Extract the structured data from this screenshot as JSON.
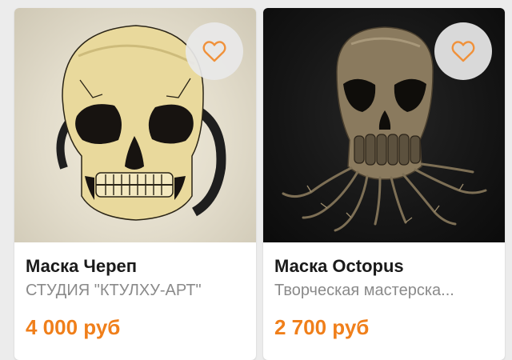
{
  "theme": {
    "accent": "#f07f1a",
    "heart_stroke": "#f0913a"
  },
  "products": [
    {
      "title": "Маска Череп",
      "seller": "СТУДИЯ \"КТУЛХУ-АРТ\"",
      "price": "4 000 руб",
      "favorite_icon": "heart-outline-icon"
    },
    {
      "title": "Маска Octopus",
      "seller": "Творческая мастерска...",
      "price": "2 700 руб",
      "favorite_icon": "heart-outline-icon"
    }
  ]
}
